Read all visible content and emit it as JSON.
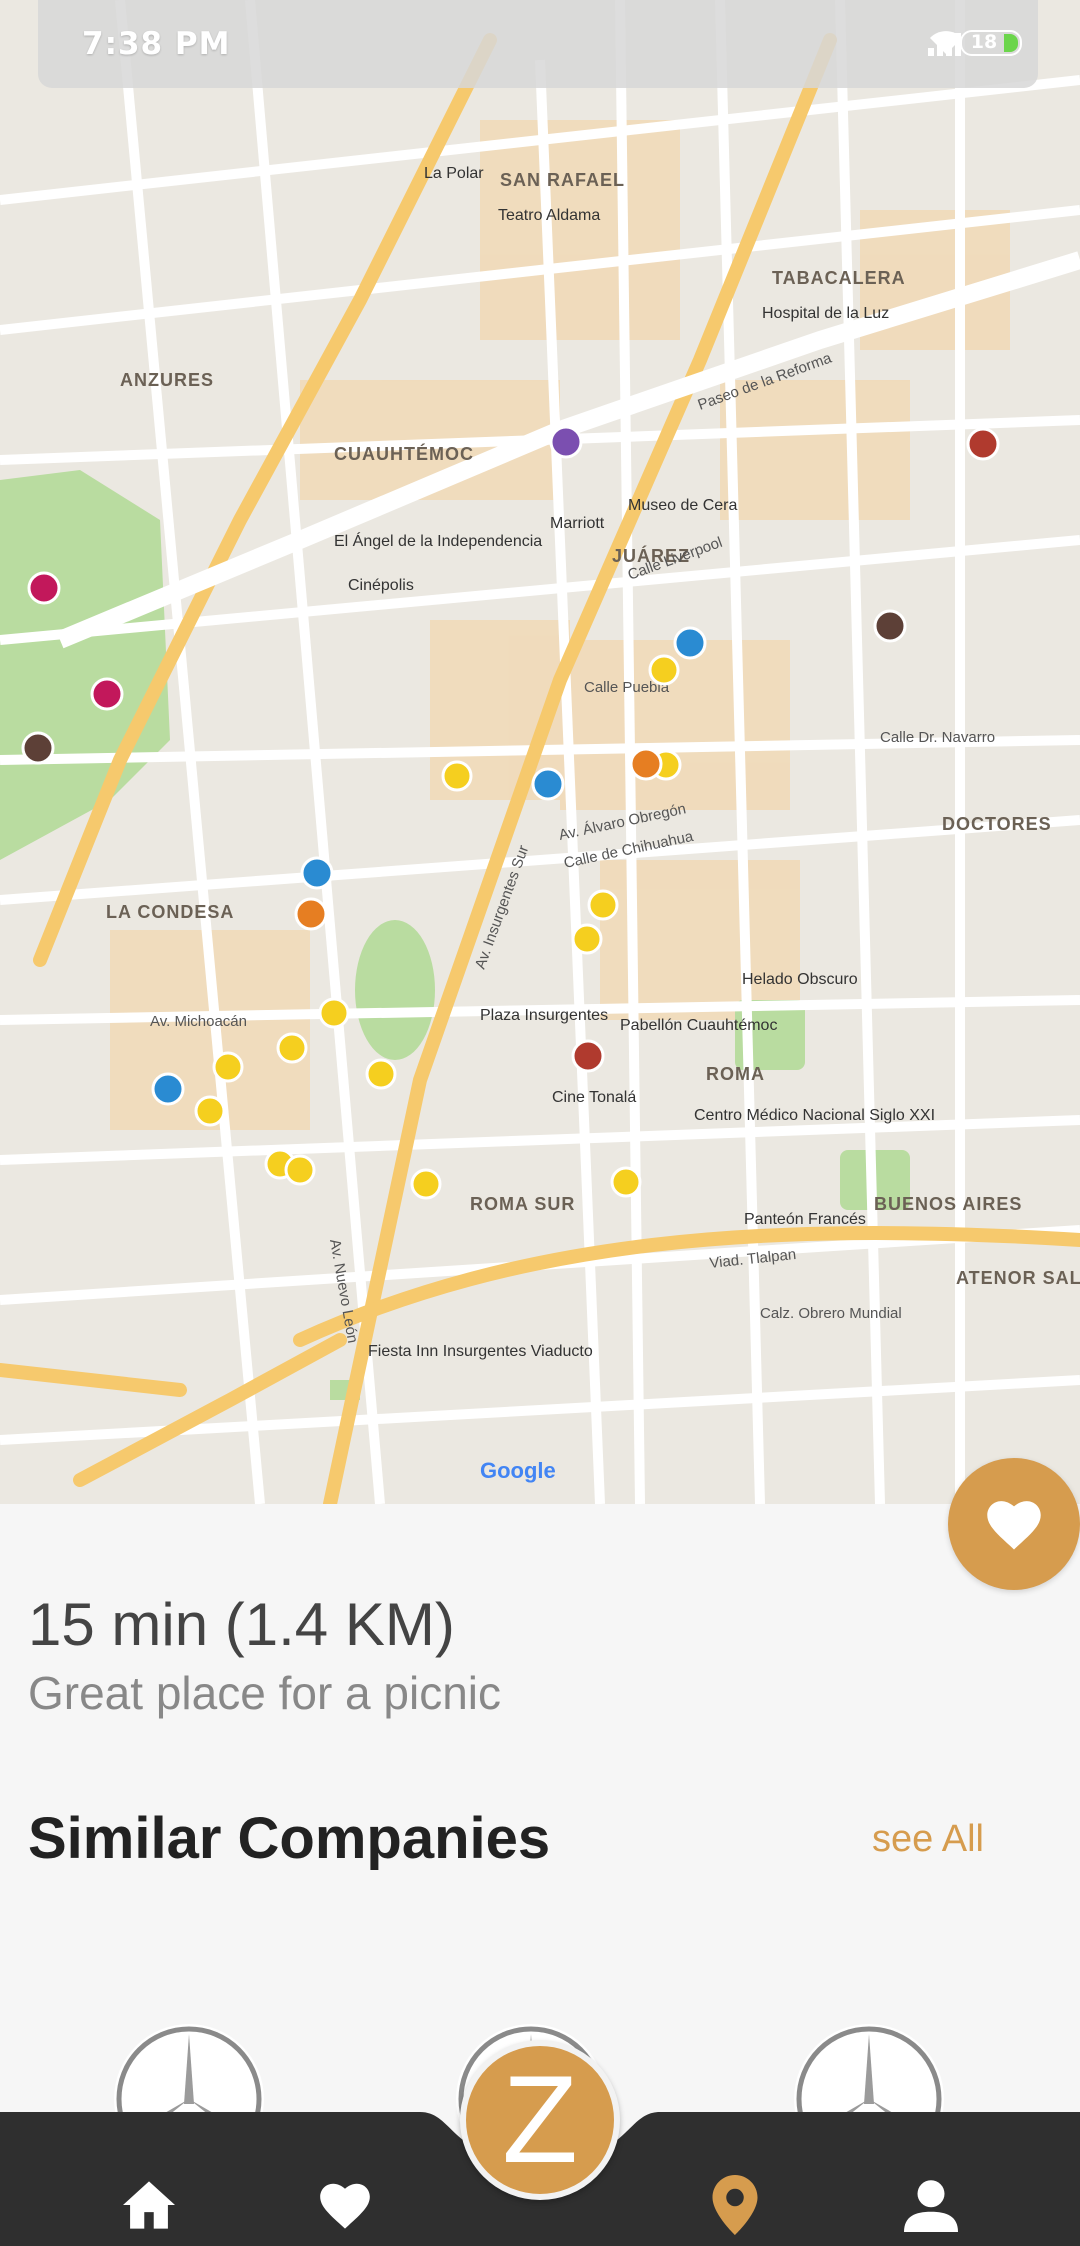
{
  "status_bar": {
    "time": "7:38 PM",
    "battery": "18"
  },
  "map": {
    "areas": [
      "SAN RAFAEL",
      "TABACALERA",
      "ANZURES",
      "CUAUHTÉMOC",
      "JUÁREZ",
      "DOCTORES",
      "LA CONDESA",
      "ROMA",
      "ROMA SUR",
      "BUENOS AIRES",
      "ATENOR SALA"
    ],
    "streets": [
      "Av. Insurgentes Sur",
      "Paseo de la Reforma",
      "Av. Álvaro Obregón",
      "Calle de Chihuahua",
      "Calle Liverpool",
      "Viad. Tlalpan",
      "Av. Michoacán",
      "Av. Nuevo León",
      "Calle Puebla",
      "Calle Dr. Navarro",
      "Calz. Obrero Mundial"
    ],
    "places": [
      "Teatro Aldama",
      "Marriott",
      "Museo de Cera",
      "Hospital de la Luz",
      "Cinépolis",
      "El Ángel de la Independencia",
      "Plaza Insurgentes",
      "Helado Obscuro",
      "Pabellón Cuauhtémoc",
      "Cine Tonalá",
      "Centro Médico Nacional Siglo XXI",
      "Panteón Francés",
      "Fiesta Inn Insurgentes Viaducto",
      "La Polar"
    ],
    "logo": "Google",
    "colors": {
      "road": "#ffffff",
      "major": "#f6c96d",
      "park": "#b9dca0",
      "block": "#f1d9b6",
      "land": "#ebe8e1"
    }
  },
  "favorite_button": {
    "icon": "heart-icon"
  },
  "place": {
    "distance": "15 min (1.4 KM)",
    "description": "Great place for a picnic"
  },
  "similar": {
    "title": "Similar Companies",
    "see_all": "see All",
    "logos": [
      "mercedes-logo",
      "mercedes-logo",
      "mercedes-logo"
    ]
  },
  "bottom_nav": {
    "items": [
      "home-icon",
      "heart-icon",
      "z-logo",
      "location-pin-icon",
      "person-icon"
    ],
    "center_label": "Z",
    "active": "location-pin-icon",
    "accent_color": "#d69c4e",
    "bar_color": "#2f2f2f"
  }
}
